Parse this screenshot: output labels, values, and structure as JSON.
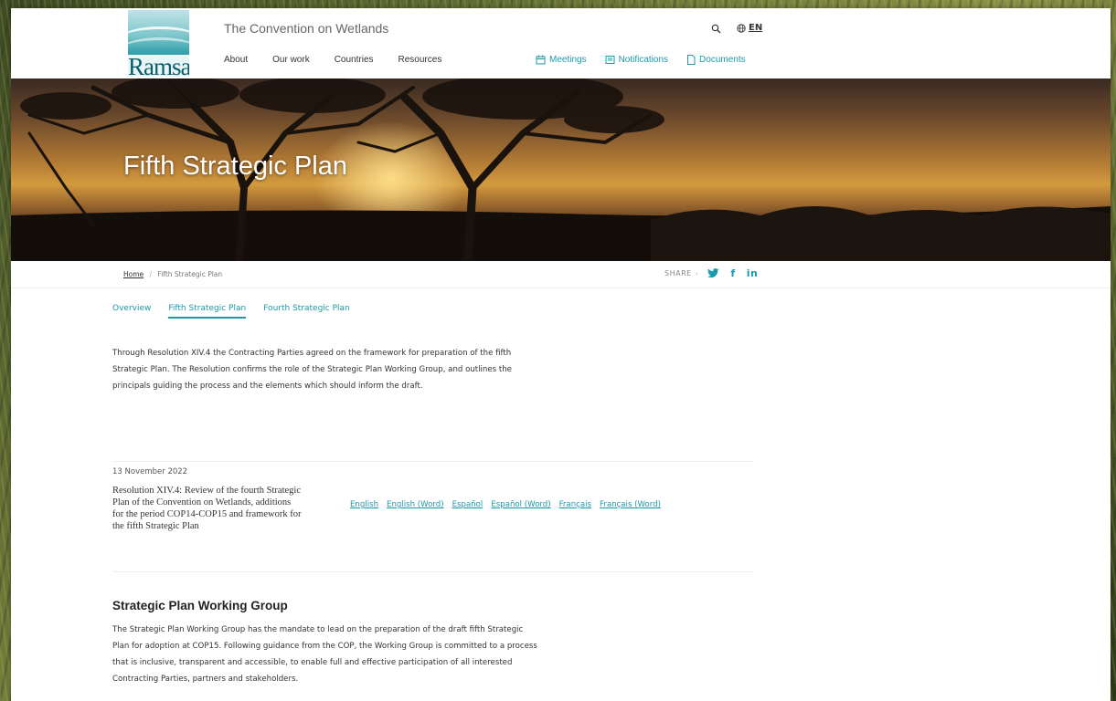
{
  "header": {
    "logo_text": "Ramsar",
    "site_title": "The Convention on Wetlands",
    "main_nav": [
      "About",
      "Our work",
      "Countries",
      "Resources"
    ],
    "utility_nav": [
      {
        "label": "Meetings",
        "icon": "calendar-icon"
      },
      {
        "label": "Notifications",
        "icon": "newspaper-icon"
      },
      {
        "label": "Documents",
        "icon": "document-icon"
      }
    ],
    "language": "EN"
  },
  "hero": {
    "title": "Fifth Strategic Plan"
  },
  "breadcrumb": {
    "home": "Home",
    "separator": "/",
    "current": "Fifth Strategic Plan"
  },
  "share": {
    "label": "SHARE",
    "networks": [
      "twitter",
      "f",
      "in"
    ]
  },
  "tabs": [
    {
      "label": "Overview",
      "active": false
    },
    {
      "label": "Fifth Strategic Plan",
      "active": true
    },
    {
      "label": "Fourth Strategic Plan",
      "active": false
    }
  ],
  "intro": "Through Resolution XIV.4 the Contracting Parties agreed on the framework for preparation of the fifth Strategic Plan. The Resolution confirms the role of the Strategic Plan Working Group, and outlines the principals guiding the process and the elements which should inform the draft.",
  "document": {
    "date": "13 November 2022",
    "title": "Resolution XIV.4: Review of the fourth Strategic Plan of the Convention on Wetlands, additions for the period COP14-COP15 and framework for the fifth Strategic Plan",
    "links": [
      "English",
      "English (Word)",
      "Español",
      "Español (Word)",
      "Français",
      "Français (Word)"
    ]
  },
  "working_group": {
    "title": "Strategic Plan Working Group",
    "body": "The Strategic Plan Working Group has the mandate to lead on the preparation of the draft fifth Strategic Plan for adoption at COP15. Following guidance from the COP, the Working Group is committed to a process that is inclusive, transparent and accessible, to enable full and effective participation of all interested Contracting Parties, partners and stakeholders."
  },
  "colors": {
    "accent": "#1a9aa8",
    "text": "#333333"
  }
}
